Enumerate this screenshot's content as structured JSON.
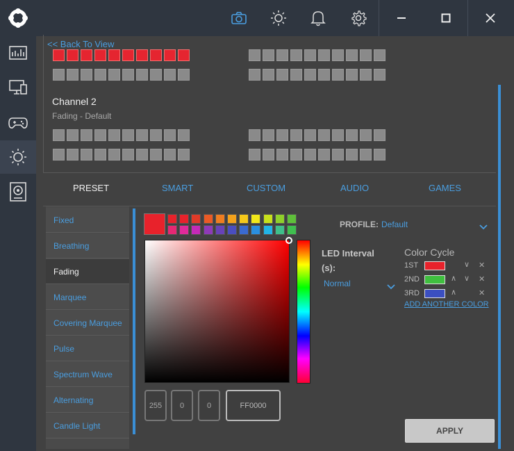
{
  "nav": {
    "back_label": "<< Back To View"
  },
  "channel2": {
    "title": "Channel 2",
    "subtitle": "Fading - Default"
  },
  "tabs": [
    {
      "label": "PRESET",
      "active": true
    },
    {
      "label": "SMART",
      "active": false
    },
    {
      "label": "CUSTOM",
      "active": false
    },
    {
      "label": "AUDIO",
      "active": false
    },
    {
      "label": "GAMES",
      "active": false
    }
  ],
  "effects": [
    {
      "label": "Fixed",
      "active": false
    },
    {
      "label": "Breathing",
      "active": false
    },
    {
      "label": "Fading",
      "active": true
    },
    {
      "label": "Marquee",
      "active": false
    },
    {
      "label": "Covering Marquee",
      "active": false
    },
    {
      "label": "Pulse",
      "active": false
    },
    {
      "label": "Spectrum Wave",
      "active": false
    },
    {
      "label": "Alternating",
      "active": false
    },
    {
      "label": "Candle Light",
      "active": false
    }
  ],
  "color_inputs": {
    "r": "255",
    "g": "0",
    "b": "0",
    "hex": "FF0000"
  },
  "profile": {
    "label": "PROFILE:",
    "value": "Default"
  },
  "led_interval": {
    "label": "LED Interval (s):",
    "value": "Normal"
  },
  "color_cycle": {
    "title": "Color Cycle",
    "entries": [
      {
        "label": "1ST",
        "color": "#e8222b"
      },
      {
        "label": "2ND",
        "color": "#3fbf3f"
      },
      {
        "label": "3RD",
        "color": "#3b4fc0"
      }
    ],
    "add_label": "ADD ANOTHER COLOR"
  },
  "apply_label": "APPLY",
  "colors": {
    "accent": "#4a9ee0",
    "selected": "#e8222b"
  },
  "swatches_row1": [
    "#e8222b",
    "#e8222b",
    "#e03a28",
    "#ea5a25",
    "#ef7d20",
    "#f3a21c",
    "#f5c81a",
    "#f2e81a",
    "#c7e01c",
    "#8fd02a",
    "#5fbf3a"
  ],
  "swatches_row2": [
    "#e62874",
    "#e02a9a",
    "#c42ab8",
    "#8f3ab8",
    "#6842b8",
    "#4a4ec0",
    "#3a6ad0",
    "#2a8fe0",
    "#22b4e6",
    "#3fbf8a",
    "#3fbf4f"
  ],
  "icons": [
    "logo-icon",
    "dashboard-icon",
    "monitor-icon",
    "gamepad-icon",
    "lighting-icon",
    "speaker-icon",
    "camera-icon",
    "brightness-icon",
    "bell-icon",
    "gear-icon",
    "minimize-icon",
    "maximize-icon",
    "close-icon"
  ]
}
